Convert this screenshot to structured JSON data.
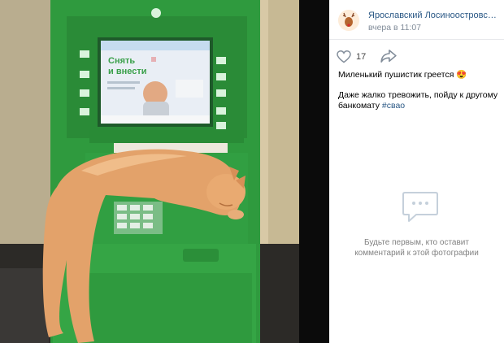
{
  "post": {
    "group_name": "Ярославский Лосиноостровский Б...",
    "time": "вчера в 11:07",
    "likes": "17",
    "text_line1": "Миленький пушистик греется",
    "text_line1_emoji": "😍",
    "text_line2_part1": "Даже жалко тревожить, пойду к другому банкомату",
    "hashtag": "#свао"
  },
  "comments": {
    "empty_line1": "Будьте первым, кто оставит",
    "empty_line2": "комментарий к этой фотографии"
  },
  "photo": {
    "atm_screen_title_line1": "Снять",
    "atm_screen_title_line2": "и внести"
  },
  "icons": {
    "like": "heart-icon",
    "share": "share-icon",
    "comments": "comment-bubble-icon"
  },
  "colors": {
    "link": "#2a5885",
    "atm_green": "#2e9d3e",
    "cat": "#e3a26a"
  }
}
